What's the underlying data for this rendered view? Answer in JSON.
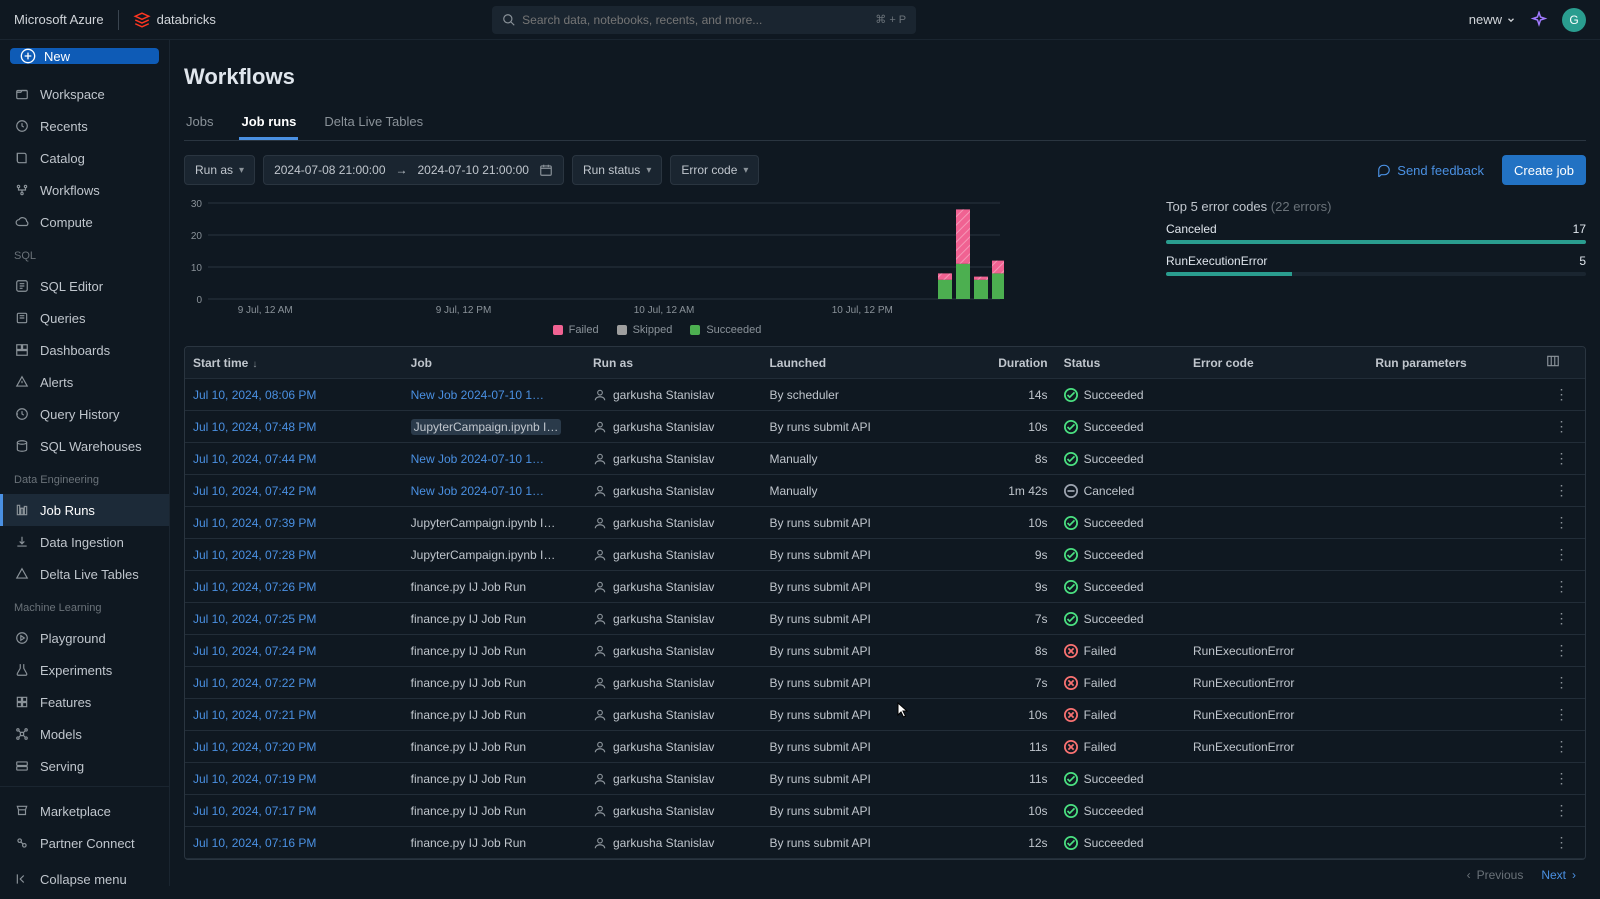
{
  "topbar": {
    "cloud": "Microsoft Azure",
    "brand": "databricks",
    "search_placeholder": "Search data, notebooks, recents, and more...",
    "search_shortcut": "⌘ + P",
    "user": "neww",
    "avatar_letter": "G"
  },
  "sidebar": {
    "new": "New",
    "main": [
      {
        "icon": "folder",
        "label": "Workspace"
      },
      {
        "icon": "clock",
        "label": "Recents"
      },
      {
        "icon": "book",
        "label": "Catalog"
      },
      {
        "icon": "flow",
        "label": "Workflows"
      },
      {
        "icon": "cloud",
        "label": "Compute"
      }
    ],
    "sql_head": "SQL",
    "sql": [
      {
        "icon": "sql",
        "label": "SQL Editor"
      },
      {
        "icon": "query",
        "label": "Queries"
      },
      {
        "icon": "dash",
        "label": "Dashboards"
      },
      {
        "icon": "alert",
        "label": "Alerts"
      },
      {
        "icon": "hist",
        "label": "Query History"
      },
      {
        "icon": "wh",
        "label": "SQL Warehouses"
      }
    ],
    "de_head": "Data Engineering",
    "de": [
      {
        "icon": "runs",
        "label": "Job Runs",
        "active": true
      },
      {
        "icon": "ingest",
        "label": "Data Ingestion"
      },
      {
        "icon": "dlt",
        "label": "Delta Live Tables"
      }
    ],
    "ml_head": "Machine Learning",
    "ml": [
      {
        "icon": "play",
        "label": "Playground"
      },
      {
        "icon": "exp",
        "label": "Experiments"
      },
      {
        "icon": "feat",
        "label": "Features"
      },
      {
        "icon": "model",
        "label": "Models"
      },
      {
        "icon": "serve",
        "label": "Serving"
      }
    ],
    "footer": [
      {
        "icon": "market",
        "label": "Marketplace"
      },
      {
        "icon": "partner",
        "label": "Partner Connect"
      }
    ],
    "collapse": "Collapse menu"
  },
  "page": {
    "title": "Workflows",
    "tabs": [
      {
        "label": "Jobs",
        "active": false
      },
      {
        "label": "Job runs",
        "active": true
      },
      {
        "label": "Delta Live Tables",
        "active": false
      }
    ],
    "filters": {
      "runas": "Run as",
      "date_from": "2024-07-08 21:00:00",
      "date_to": "2024-07-10 21:00:00",
      "runstatus": "Run status",
      "errorcode": "Error code"
    },
    "feedback": "Send feedback",
    "create": "Create job"
  },
  "errors": {
    "title": "Top 5 error codes",
    "count": "(22 errors)",
    "rows": [
      {
        "name": "Canceled",
        "n": "17",
        "pct": 100
      },
      {
        "name": "RunExecutionError",
        "n": "5",
        "pct": 30
      }
    ]
  },
  "chart_data": {
    "type": "bar",
    "ylim": [
      0,
      30
    ],
    "yticks": [
      0,
      10,
      20,
      30
    ],
    "xlabels": [
      "9 Jul, 12 AM",
      "9 Jul, 12 PM",
      "10 Jul, 12 AM",
      "10 Jul, 12 PM"
    ],
    "bars": [
      {
        "x": 730,
        "failed": 2,
        "skipped": 0,
        "succeeded": 6
      },
      {
        "x": 748,
        "failed": 17,
        "skipped": 0,
        "succeeded": 11
      },
      {
        "x": 766,
        "failed": 1,
        "skipped": 0,
        "succeeded": 6
      },
      {
        "x": 784,
        "failed": 4,
        "skipped": 0,
        "succeeded": 8
      }
    ],
    "legend": [
      {
        "color": "#f06292",
        "label": "Failed"
      },
      {
        "color": "#9e9e9e",
        "label": "Skipped"
      },
      {
        "color": "#4caf50",
        "label": "Succeeded"
      }
    ]
  },
  "table": {
    "headers": [
      "Start time",
      "Job",
      "Run as",
      "Launched",
      "Duration",
      "Status",
      "Error code",
      "Run parameters"
    ],
    "rows": [
      {
        "start": "Jul 10, 2024, 08:06 PM",
        "job": "New Job 2024-07-10 1…",
        "job_link": true,
        "job_hl": false,
        "user": "garkusha Stanislav",
        "launch": "By scheduler",
        "dur": "14s",
        "status": "Succeeded",
        "err": "",
        "params": ""
      },
      {
        "start": "Jul 10, 2024, 07:48 PM",
        "job": "JupyterCampaign.ipynb I…",
        "job_link": false,
        "job_hl": true,
        "user": "garkusha Stanislav",
        "launch": "By runs submit API",
        "dur": "10s",
        "status": "Succeeded",
        "err": "",
        "params": ""
      },
      {
        "start": "Jul 10, 2024, 07:44 PM",
        "job": "New Job 2024-07-10 1…",
        "job_link": true,
        "job_hl": false,
        "user": "garkusha Stanislav",
        "launch": "Manually",
        "dur": "8s",
        "status": "Succeeded",
        "err": "",
        "params": ""
      },
      {
        "start": "Jul 10, 2024, 07:42 PM",
        "job": "New Job 2024-07-10 1…",
        "job_link": true,
        "job_hl": false,
        "user": "garkusha Stanislav",
        "launch": "Manually",
        "dur": "1m 42s",
        "status": "Canceled",
        "err": "",
        "params": ""
      },
      {
        "start": "Jul 10, 2024, 07:39 PM",
        "job": "JupyterCampaign.ipynb I…",
        "job_link": false,
        "job_hl": false,
        "user": "garkusha Stanislav",
        "launch": "By runs submit API",
        "dur": "10s",
        "status": "Succeeded",
        "err": "",
        "params": ""
      },
      {
        "start": "Jul 10, 2024, 07:28 PM",
        "job": "JupyterCampaign.ipynb I…",
        "job_link": false,
        "job_hl": false,
        "user": "garkusha Stanislav",
        "launch": "By runs submit API",
        "dur": "9s",
        "status": "Succeeded",
        "err": "",
        "params": ""
      },
      {
        "start": "Jul 10, 2024, 07:26 PM",
        "job": "finance.py IJ Job Run",
        "job_link": false,
        "job_hl": false,
        "user": "garkusha Stanislav",
        "launch": "By runs submit API",
        "dur": "9s",
        "status": "Succeeded",
        "err": "",
        "params": ""
      },
      {
        "start": "Jul 10, 2024, 07:25 PM",
        "job": "finance.py IJ Job Run",
        "job_link": false,
        "job_hl": false,
        "user": "garkusha Stanislav",
        "launch": "By runs submit API",
        "dur": "7s",
        "status": "Succeeded",
        "err": "",
        "params": ""
      },
      {
        "start": "Jul 10, 2024, 07:24 PM",
        "job": "finance.py IJ Job Run",
        "job_link": false,
        "job_hl": false,
        "user": "garkusha Stanislav",
        "launch": "By runs submit API",
        "dur": "8s",
        "status": "Failed",
        "err": "RunExecutionError",
        "params": ""
      },
      {
        "start": "Jul 10, 2024, 07:22 PM",
        "job": "finance.py IJ Job Run",
        "job_link": false,
        "job_hl": false,
        "user": "garkusha Stanislav",
        "launch": "By runs submit API",
        "dur": "7s",
        "status": "Failed",
        "err": "RunExecutionError",
        "params": ""
      },
      {
        "start": "Jul 10, 2024, 07:21 PM",
        "job": "finance.py IJ Job Run",
        "job_link": false,
        "job_hl": false,
        "user": "garkusha Stanislav",
        "launch": "By runs submit API",
        "dur": "10s",
        "status": "Failed",
        "err": "RunExecutionError",
        "params": ""
      },
      {
        "start": "Jul 10, 2024, 07:20 PM",
        "job": "finance.py IJ Job Run",
        "job_link": false,
        "job_hl": false,
        "user": "garkusha Stanislav",
        "launch": "By runs submit API",
        "dur": "11s",
        "status": "Failed",
        "err": "RunExecutionError",
        "params": ""
      },
      {
        "start": "Jul 10, 2024, 07:19 PM",
        "job": "finance.py IJ Job Run",
        "job_link": false,
        "job_hl": false,
        "user": "garkusha Stanislav",
        "launch": "By runs submit API",
        "dur": "11s",
        "status": "Succeeded",
        "err": "",
        "params": ""
      },
      {
        "start": "Jul 10, 2024, 07:17 PM",
        "job": "finance.py IJ Job Run",
        "job_link": false,
        "job_hl": false,
        "user": "garkusha Stanislav",
        "launch": "By runs submit API",
        "dur": "10s",
        "status": "Succeeded",
        "err": "",
        "params": ""
      },
      {
        "start": "Jul 10, 2024, 07:16 PM",
        "job": "finance.py IJ Job Run",
        "job_link": false,
        "job_hl": false,
        "user": "garkusha Stanislav",
        "launch": "By runs submit API",
        "dur": "12s",
        "status": "Succeeded",
        "err": "",
        "params": ""
      }
    ]
  },
  "pagination": {
    "prev": "Previous",
    "next": "Next"
  }
}
